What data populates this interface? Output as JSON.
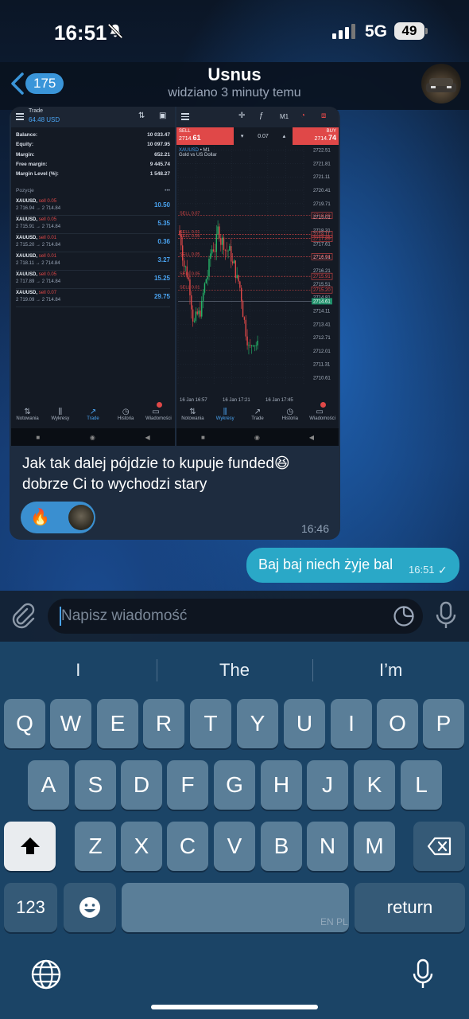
{
  "status_bar": {
    "time": "16:51",
    "network": "5G",
    "battery": "49"
  },
  "header": {
    "back_count": "175",
    "title": "Usnus",
    "subtitle": "widziano 3 minuty temu"
  },
  "incoming_message": {
    "screenshot": {
      "account": {
        "label": "Trade",
        "amount": "64.48 USD",
        "rows": [
          {
            "label": "Balance:",
            "value": "10 033.47"
          },
          {
            "label": "Equity:",
            "value": "10 097.95"
          },
          {
            "label": "Margin:",
            "value": "652.21"
          },
          {
            "label": "Free margin:",
            "value": "9 445.74"
          },
          {
            "label": "Margin Level (%):",
            "value": "1 548.27"
          }
        ],
        "positions_title": "Pozycje",
        "positions": [
          {
            "symbol": "XAUUSD,",
            "side": "sell 0.05",
            "prices": "2 716.94 → 2 714.84",
            "profit": "10.50"
          },
          {
            "symbol": "XAUUSD,",
            "side": "sell 0.05",
            "prices": "2 715.91 → 2 714.84",
            "profit": "5.35"
          },
          {
            "symbol": "XAUUSD,",
            "side": "sell 0.01",
            "prices": "2 715.20 → 2 714.84",
            "profit": "0.36"
          },
          {
            "symbol": "XAUUSD,",
            "side": "sell 0.01",
            "prices": "2 718.11 → 2 714.84",
            "profit": "3.27"
          },
          {
            "symbol": "XAUUSD,",
            "side": "sell 0.05",
            "prices": "2 717.89 → 2 714.84",
            "profit": "15.25"
          },
          {
            "symbol": "XAUUSD,",
            "side": "sell 0.07",
            "prices": "2 719.09 → 2 714.84",
            "profit": "29.75"
          }
        ],
        "nav": [
          "Notowania",
          "Wykresy",
          "Trade",
          "Historia",
          "Wiadomości"
        ]
      },
      "chart": {
        "sell_label": "SELL",
        "sell_price_main": "2714.",
        "sell_price_big": "61",
        "lot": "0.07",
        "timeframe": "M1",
        "buy_label": "BUY",
        "buy_price_main": "2714.",
        "buy_price_big": "74",
        "symbol": "XAUUSD",
        "symbol_tf": "• M1",
        "description": "Gold vs US Dollar",
        "nav": [
          "Notowania",
          "Wykresy",
          "Trade",
          "Historia",
          "Wiadomości"
        ]
      },
      "chart_data": {
        "type": "candlestick",
        "title": "XAUUSD • M1",
        "subtitle": "Gold vs US Dollar",
        "x_ticks": [
          "16 Jan 16:57",
          "16 Jan 17:21",
          "16 Jan 17:45"
        ],
        "y_ticks": [
          2722.51,
          2721.81,
          2721.11,
          2720.41,
          2719.71,
          2719.01,
          2718.31,
          2717.61,
          2716.91,
          2716.21,
          2715.51,
          2714.81,
          2714.11,
          2713.41,
          2712.71,
          2712.01,
          2711.31,
          2710.61
        ],
        "ylim": [
          2710.3,
          2722.7
        ],
        "order_lines": [
          {
            "label": "SELL 0.07",
            "price": 2719.09
          },
          {
            "label": "SELL 0.01",
            "price": 2718.11
          },
          {
            "label": "SELL 0.05",
            "price": 2717.89
          },
          {
            "label": "SELL 0.05",
            "price": 2716.94
          },
          {
            "label": "SELL 0.05",
            "price": 2715.91
          },
          {
            "label": "SELL 0.01",
            "price": 2715.2
          }
        ],
        "current_price": 2714.61
      }
    },
    "caption": "Jak tak dalej pójdzie to kupuje funded😆 dobrze Ci to wychodzi stary",
    "reaction_emoji": "🔥",
    "time": "16:46"
  },
  "outgoing_message": {
    "text": "Baj baj niech żyje bal",
    "time": "16:51"
  },
  "composer": {
    "placeholder": "Napisz wiadomość"
  },
  "keyboard": {
    "suggestions": [
      "I",
      "The",
      "I’m"
    ],
    "row1": [
      "Q",
      "W",
      "E",
      "R",
      "T",
      "Y",
      "U",
      "I",
      "O",
      "P"
    ],
    "row2": [
      "A",
      "S",
      "D",
      "F",
      "G",
      "H",
      "J",
      "K",
      "L"
    ],
    "row3": [
      "Z",
      "X",
      "C",
      "V",
      "B",
      "N",
      "M"
    ],
    "numbers_label": "123",
    "return_label": "return",
    "language_hint": "EN PL"
  }
}
